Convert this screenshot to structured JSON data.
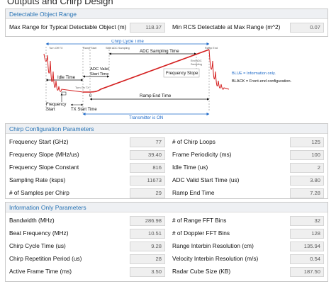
{
  "title": "Outputs and Chirp Design",
  "detect": {
    "header": "Detectable Object Range",
    "max_range_label": "Max Range for Typical Detectable Object (m)",
    "max_range_value": "118.37",
    "min_rcs_label": "Min RCS Detectable at Max Range (m^2)",
    "min_rcs_value": "0.07"
  },
  "diagram": {
    "chirp_cycle_time": "Chirp Cycle Time",
    "turn_off_top": "Turn Off TX",
    "ramp_start": "Ramp Start",
    "start_adc": "Start ADC Sampling",
    "ramp_end": "Ramp End",
    "adc_sampling_time": "ADC Sampling Time",
    "end_adc": "End ADC",
    "sampling": "Sampling",
    "adc_valid": "ADC Valid",
    "start_time": "Start Time",
    "idle_time": "Idle Time",
    "frequency_slope": "Frequency Slope",
    "turn_on_tx": "Turn On TX",
    "zero": "0",
    "ramp_end_time": "Ramp End Time",
    "frequency": "Frequency",
    "start": "Start",
    "tx_start_time": "TX Start Time",
    "transmitter_on": "Transmitter is ON",
    "legend_blue": "BLUE = Information only.",
    "legend_black": "BLACK = Front-end configuration."
  },
  "chirp": {
    "header": "Chirp Configuration Parameters",
    "rows": [
      {
        "l1": "Frequency Start (GHz)",
        "v1": "77",
        "l2": "# of Chirp Loops",
        "v2": "125"
      },
      {
        "l1": "Frequency Slope (MHz/us)",
        "v1": "39.40",
        "l2": "Frame Periodicity (ms)",
        "v2": "100"
      },
      {
        "l1": "Frequency Slope Constant",
        "v1": "816",
        "l2": "Idle Time (us)",
        "v2": "2"
      },
      {
        "l1": "Sampling Rate (ksps)",
        "v1": "11673",
        "l2": "ADC Valid Start Time (us)",
        "v2": "3.80"
      },
      {
        "l1": "# of Samples per Chirp",
        "v1": "29",
        "l2": "Ramp End Time",
        "v2": "7.28"
      }
    ]
  },
  "info": {
    "header": "Information Only Parameters",
    "rows": [
      {
        "l1": "Bandwidth (MHz)",
        "v1": "286.98",
        "l2": "# of Range FFT Bins",
        "v2": "32"
      },
      {
        "l1": "Beat Frequency (MHz)",
        "v1": "10.51",
        "l2": "# of Doppler FFT Bins",
        "v2": "128"
      },
      {
        "l1": "Chirp Cycle Time (us)",
        "v1": "9.28",
        "l2": "Range Interbin Resolution (cm)",
        "v2": "135.94"
      },
      {
        "l1": "Chirp Repetition Period (us)",
        "v1": "28",
        "l2": "Velocity Interbin Resolution (m/s)",
        "v2": "0.54"
      },
      {
        "l1": "Active Frame Time (ms)",
        "v1": "3.50",
        "l2": "Radar Cube Size (KB)",
        "v2": "187.50"
      }
    ]
  },
  "colors": {
    "accent_blue": "#1a67c7",
    "ramp_red": "#d42020",
    "header_text": "#2773b5"
  }
}
